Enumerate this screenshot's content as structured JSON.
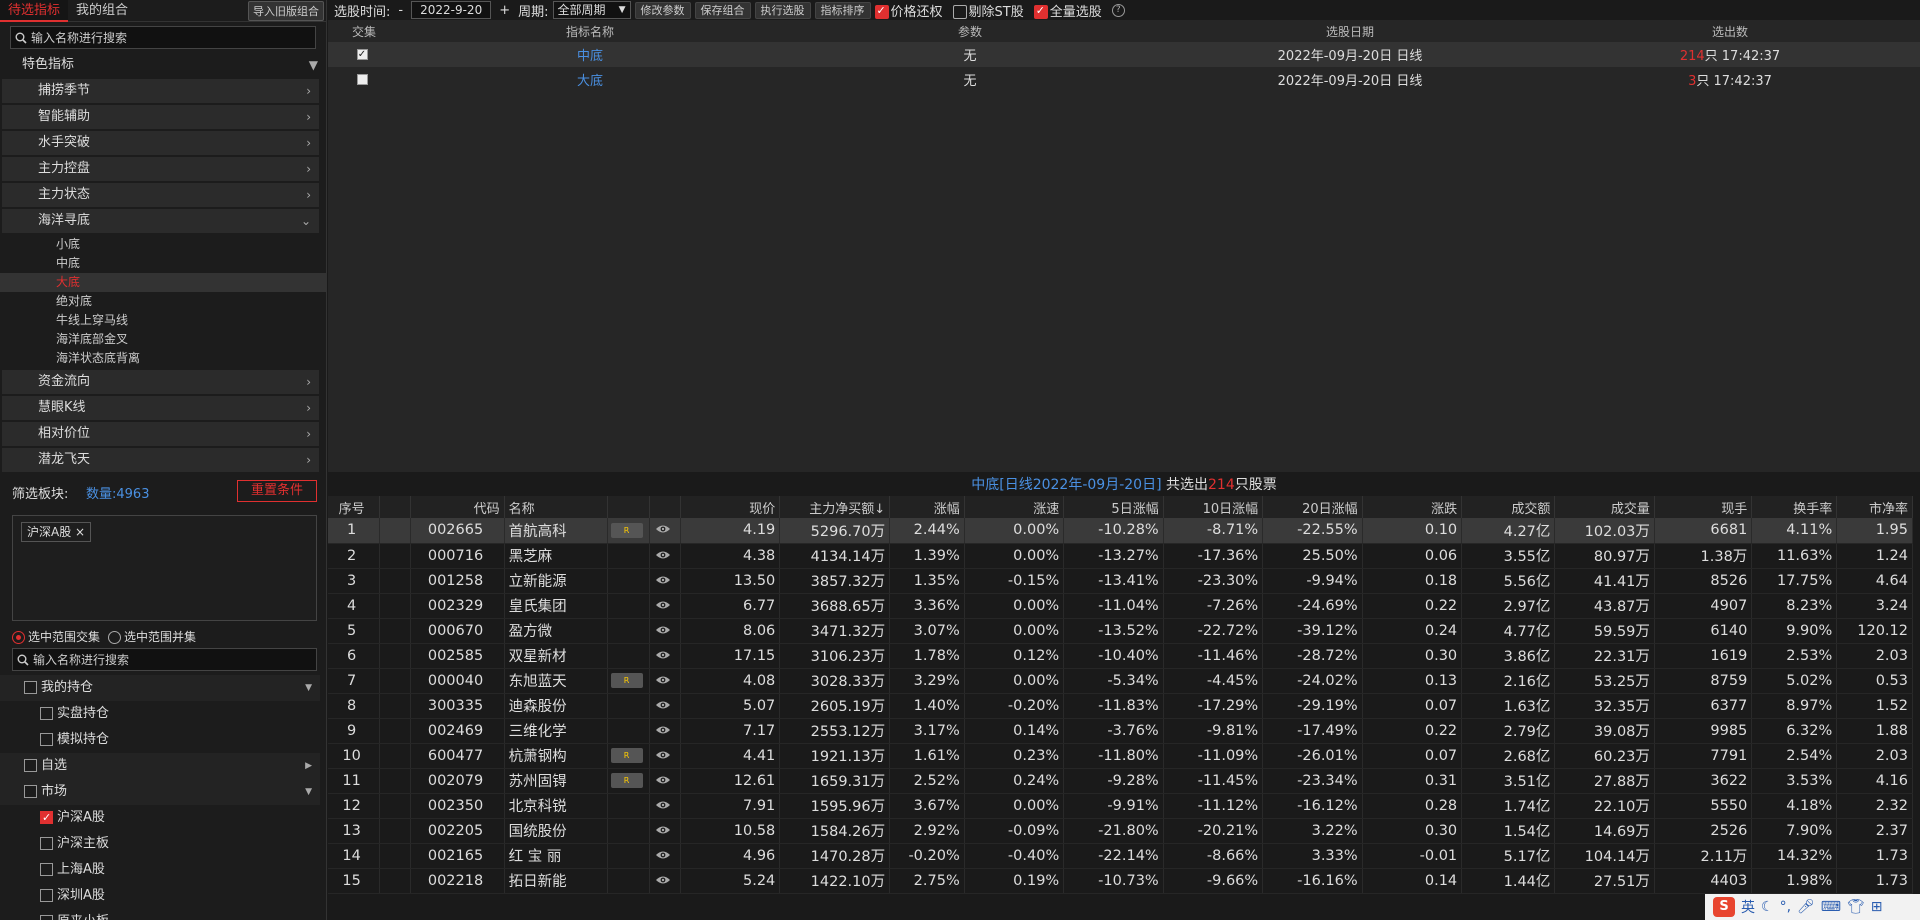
{
  "left": {
    "tabs": [
      "待选指标",
      "我的组合"
    ],
    "import_btn": "导入旧版组合",
    "search_placeholder": "输入名称进行搜索",
    "group_header": "特色指标",
    "categories": [
      {
        "label": "捕捞季节",
        "expanded": false
      },
      {
        "label": "智能辅助",
        "expanded": false
      },
      {
        "label": "水手突破",
        "expanded": false
      },
      {
        "label": "主力控盘",
        "expanded": false
      },
      {
        "label": "主力状态",
        "expanded": false
      },
      {
        "label": "海洋寻底",
        "expanded": true
      }
    ],
    "subitems": [
      "小底",
      "中底",
      "大底",
      "绝对底",
      "牛线上穿马线",
      "海洋底部金叉",
      "海洋状态底背离"
    ],
    "selected_sub": "大底",
    "categories2": [
      "资金流向",
      "慧眼K线",
      "相对价位",
      "潜龙飞天"
    ],
    "filter_label": "筛选板块:",
    "filter_count": "数量:4963",
    "reset_btn": "重置条件",
    "tag": "沪深A股",
    "radio_intersect": "选中范围交集",
    "radio_union": "选中范围并集",
    "search2_placeholder": "输入名称进行搜索",
    "tree": [
      {
        "label": "我的持仓",
        "level": 1,
        "checked": false,
        "arrow": "down"
      },
      {
        "label": "实盘持仓",
        "level": 2,
        "checked": false
      },
      {
        "label": "模拟持仓",
        "level": 2,
        "checked": false
      },
      {
        "label": "自选",
        "level": 1,
        "checked": false,
        "arrow": "right"
      },
      {
        "label": "市场",
        "level": 1,
        "checked": false,
        "arrow": "down"
      },
      {
        "label": "沪深A股",
        "level": 2,
        "checked": true
      },
      {
        "label": "沪深主板",
        "level": 2,
        "checked": false
      },
      {
        "label": "上海A股",
        "level": 2,
        "checked": false
      },
      {
        "label": "深圳A股",
        "level": 2,
        "checked": false
      },
      {
        "label": "原来小板",
        "level": 2,
        "checked": false
      }
    ]
  },
  "toolbar": {
    "time_label": "选股时间:",
    "minus": "-",
    "date": "2022-9-20",
    "plus": "+",
    "period_label": "周期:",
    "period_value": "全部周期",
    "btn_edit": "修改参数",
    "btn_save": "保存组合",
    "btn_exec": "执行选股",
    "btn_sort": "指标排序",
    "chk_price": "价格还权",
    "chk_st": "剔除ST股",
    "chk_all": "全量选股"
  },
  "upper_table": {
    "headers": [
      "交集",
      "指标名称",
      "参数",
      "选股日期",
      "选出数"
    ],
    "rows": [
      {
        "checked": true,
        "name": "中底",
        "param": "无",
        "date": "2022年-09月-20日 日线",
        "count": "214",
        "count_suffix": "只 17:42:37"
      },
      {
        "checked": false,
        "name": "大底",
        "param": "无",
        "date": "2022年-09月-20日 日线",
        "count": "3",
        "count_suffix": "只 17:42:37"
      }
    ]
  },
  "result_title": {
    "part1": "中底[日线2022年-09月-20日]",
    "part2": " 共选出",
    "count": "214",
    "part3": "只股票"
  },
  "grid": {
    "headers": [
      "序号",
      "",
      "代码",
      "名称",
      "",
      "",
      "现价",
      "主力净买额↓",
      "涨幅",
      "涨速",
      "5日涨幅",
      "10日涨幅",
      "20日涨幅",
      "涨跌",
      "成交额",
      "成交量",
      "现手",
      "换手率",
      "市净率"
    ],
    "rows": [
      {
        "n": "1",
        "code": "002665",
        "name": "首航高科",
        "nc": "cy",
        "r": true,
        "price": "4.19",
        "net": "5296.70万",
        "chg": "2.44%",
        "spd": "0.00%",
        "d5": "-10.28%",
        "d10": "-8.71%",
        "d20": "-22.55%",
        "dif": "0.10",
        "amt": "4.27亿",
        "vol": "102.03万",
        "hand": "6681",
        "turn": "4.11%",
        "pb": "1.95",
        "pc": "r",
        "cc": "r",
        "sc": "w",
        "d5c": "g",
        "d10c": "g",
        "d20c": "g",
        "difc": "r"
      },
      {
        "n": "2",
        "code": "000716",
        "name": "黑芝麻",
        "nc": "cy",
        "r": false,
        "price": "4.38",
        "net": "4134.14万",
        "chg": "1.39%",
        "spd": "0.00%",
        "d5": "-13.27%",
        "d10": "-17.36%",
        "d20": "25.50%",
        "dif": "0.06",
        "amt": "3.55亿",
        "vol": "80.97万",
        "hand": "1.38万",
        "turn": "11.63%",
        "pb": "1.24",
        "pc": "r",
        "cc": "r",
        "sc": "w",
        "d5c": "g",
        "d10c": "g",
        "d20c": "r",
        "difc": "r"
      },
      {
        "n": "3",
        "code": "001258",
        "name": "立新能源",
        "nc": "ye",
        "r": false,
        "price": "13.50",
        "net": "3857.32万",
        "chg": "1.35%",
        "spd": "-0.15%",
        "d5": "-13.41%",
        "d10": "-23.30%",
        "d20": "-9.94%",
        "dif": "0.18",
        "amt": "5.56亿",
        "vol": "41.41万",
        "hand": "8526",
        "turn": "17.75%",
        "pb": "4.64",
        "pc": "r",
        "cc": "r",
        "sc": "g",
        "d5c": "g",
        "d10c": "g",
        "d20c": "g",
        "difc": "r"
      },
      {
        "n": "4",
        "code": "002329",
        "name": "皇氏集团",
        "nc": "cy",
        "r": false,
        "price": "6.77",
        "net": "3688.65万",
        "chg": "3.36%",
        "spd": "0.00%",
        "d5": "-11.04%",
        "d10": "-7.26%",
        "d20": "-24.69%",
        "dif": "0.22",
        "amt": "2.97亿",
        "vol": "43.87万",
        "hand": "4907",
        "turn": "8.23%",
        "pb": "3.24",
        "pc": "r",
        "cc": "r",
        "sc": "w",
        "d5c": "g",
        "d10c": "g",
        "d20c": "g",
        "difc": "r"
      },
      {
        "n": "5",
        "code": "000670",
        "name": "盈方微",
        "nc": "ye",
        "r": false,
        "price": "8.06",
        "net": "3471.32万",
        "chg": "3.07%",
        "spd": "0.00%",
        "d5": "-13.52%",
        "d10": "-22.72%",
        "d20": "-39.12%",
        "dif": "0.24",
        "amt": "4.77亿",
        "vol": "59.59万",
        "hand": "6140",
        "turn": "9.90%",
        "pb": "120.12",
        "pc": "r",
        "cc": "r",
        "sc": "w",
        "d5c": "g",
        "d10c": "g",
        "d20c": "g",
        "difc": "r"
      },
      {
        "n": "6",
        "code": "002585",
        "name": "双星新材",
        "nc": "cy",
        "r": false,
        "price": "17.15",
        "net": "3106.23万",
        "chg": "1.78%",
        "spd": "0.12%",
        "d5": "-10.40%",
        "d10": "-11.46%",
        "d20": "-28.72%",
        "dif": "0.30",
        "amt": "3.86亿",
        "vol": "22.31万",
        "hand": "1619",
        "turn": "2.53%",
        "pb": "2.03",
        "pc": "r",
        "cc": "r",
        "sc": "r",
        "d5c": "g",
        "d10c": "g",
        "d20c": "g",
        "difc": "r"
      },
      {
        "n": "7",
        "code": "000040",
        "name": "东旭蓝天",
        "nc": "cy",
        "r": true,
        "price": "4.08",
        "net": "3028.33万",
        "chg": "3.29%",
        "spd": "0.00%",
        "d5": "-5.34%",
        "d10": "-4.45%",
        "d20": "-24.02%",
        "dif": "0.13",
        "amt": "2.16亿",
        "vol": "53.25万",
        "hand": "8759",
        "turn": "5.02%",
        "pb": "0.53",
        "pc": "r",
        "cc": "r",
        "sc": "w",
        "d5c": "g",
        "d10c": "g",
        "d20c": "g",
        "difc": "r"
      },
      {
        "n": "8",
        "code": "300335",
        "name": "迪森股份",
        "nc": "cy",
        "r": false,
        "price": "5.07",
        "net": "2605.19万",
        "chg": "1.40%",
        "spd": "-0.20%",
        "d5": "-11.83%",
        "d10": "-17.29%",
        "d20": "-29.19%",
        "dif": "0.07",
        "amt": "1.63亿",
        "vol": "32.35万",
        "hand": "6377",
        "turn": "8.97%",
        "pb": "1.52",
        "pc": "r",
        "cc": "r",
        "sc": "g",
        "d5c": "g",
        "d10c": "g",
        "d20c": "g",
        "difc": "r"
      },
      {
        "n": "9",
        "code": "002469",
        "name": "三维化学",
        "nc": "ye",
        "r": false,
        "price": "7.17",
        "net": "2553.12万",
        "chg": "3.17%",
        "spd": "0.14%",
        "d5": "-3.76%",
        "d10": "-9.81%",
        "d20": "-17.49%",
        "dif": "0.22",
        "amt": "2.79亿",
        "vol": "39.08万",
        "hand": "9985",
        "turn": "6.32%",
        "pb": "1.88",
        "pc": "r",
        "cc": "r",
        "sc": "r",
        "d5c": "g",
        "d10c": "g",
        "d20c": "g",
        "difc": "r"
      },
      {
        "n": "10",
        "code": "600477",
        "name": "杭萧钢构",
        "nc": "ye",
        "r": true,
        "price": "4.41",
        "net": "1921.13万",
        "chg": "1.61%",
        "spd": "0.23%",
        "d5": "-11.80%",
        "d10": "-11.09%",
        "d20": "-26.01%",
        "dif": "0.07",
        "amt": "2.68亿",
        "vol": "60.23万",
        "hand": "7791",
        "turn": "2.54%",
        "pb": "2.03",
        "pc": "r",
        "cc": "r",
        "sc": "r",
        "d5c": "g",
        "d10c": "g",
        "d20c": "g",
        "difc": "r"
      },
      {
        "n": "11",
        "code": "002079",
        "name": "苏州固锝",
        "nc": "cy",
        "r": true,
        "price": "12.61",
        "net": "1659.31万",
        "chg": "2.52%",
        "spd": "0.24%",
        "d5": "-9.28%",
        "d10": "-11.45%",
        "d20": "-23.34%",
        "dif": "0.31",
        "amt": "3.51亿",
        "vol": "27.88万",
        "hand": "3622",
        "turn": "3.53%",
        "pb": "4.16",
        "pc": "r",
        "cc": "r",
        "sc": "r",
        "d5c": "g",
        "d10c": "g",
        "d20c": "g",
        "difc": "r"
      },
      {
        "n": "12",
        "code": "002350",
        "name": "北京科锐",
        "nc": "cy",
        "r": false,
        "price": "7.91",
        "net": "1595.96万",
        "chg": "3.67%",
        "spd": "0.00%",
        "d5": "-9.91%",
        "d10": "-11.12%",
        "d20": "-16.12%",
        "dif": "0.28",
        "amt": "1.74亿",
        "vol": "22.10万",
        "hand": "5550",
        "turn": "4.18%",
        "pb": "2.32",
        "pc": "r",
        "cc": "r",
        "sc": "w",
        "d5c": "g",
        "d10c": "g",
        "d20c": "g",
        "difc": "r"
      },
      {
        "n": "13",
        "code": "002205",
        "name": "国统股份",
        "nc": "ye",
        "r": false,
        "price": "10.58",
        "net": "1584.26万",
        "chg": "2.92%",
        "spd": "-0.09%",
        "d5": "-21.80%",
        "d10": "-20.21%",
        "d20": "3.22%",
        "dif": "0.30",
        "amt": "1.54亿",
        "vol": "14.69万",
        "hand": "2526",
        "turn": "7.90%",
        "pb": "2.37",
        "pc": "r",
        "cc": "r",
        "sc": "g",
        "d5c": "g",
        "d10c": "g",
        "d20c": "r",
        "difc": "r"
      },
      {
        "n": "14",
        "code": "002165",
        "name": "红 宝 丽",
        "nc": "ye",
        "r": false,
        "price": "4.96",
        "net": "1470.28万",
        "chg": "-0.20%",
        "spd": "-0.40%",
        "d5": "-22.14%",
        "d10": "-8.66%",
        "d20": "3.33%",
        "dif": "-0.01",
        "amt": "5.17亿",
        "vol": "104.14万",
        "hand": "2.11万",
        "turn": "14.32%",
        "pb": "1.73",
        "pc": "g",
        "cc": "g",
        "sc": "g",
        "d5c": "g",
        "d10c": "g",
        "d20c": "r",
        "difc": "g"
      },
      {
        "n": "15",
        "code": "002218",
        "name": "拓日新能",
        "nc": "ye",
        "r": false,
        "price": "5.24",
        "net": "1422.10万",
        "chg": "2.75%",
        "spd": "0.19%",
        "d5": "-10.73%",
        "d10": "-9.66%",
        "d20": "-16.16%",
        "dif": "0.14",
        "amt": "1.44亿",
        "vol": "27.51万",
        "hand": "4403",
        "turn": "1.98%",
        "pb": "1.73",
        "pc": "r",
        "cc": "r",
        "sc": "r",
        "d5c": "g",
        "d10c": "g",
        "d20c": "g",
        "difc": "r"
      }
    ]
  },
  "tray": {
    "logo": "S",
    "lang": "英"
  }
}
